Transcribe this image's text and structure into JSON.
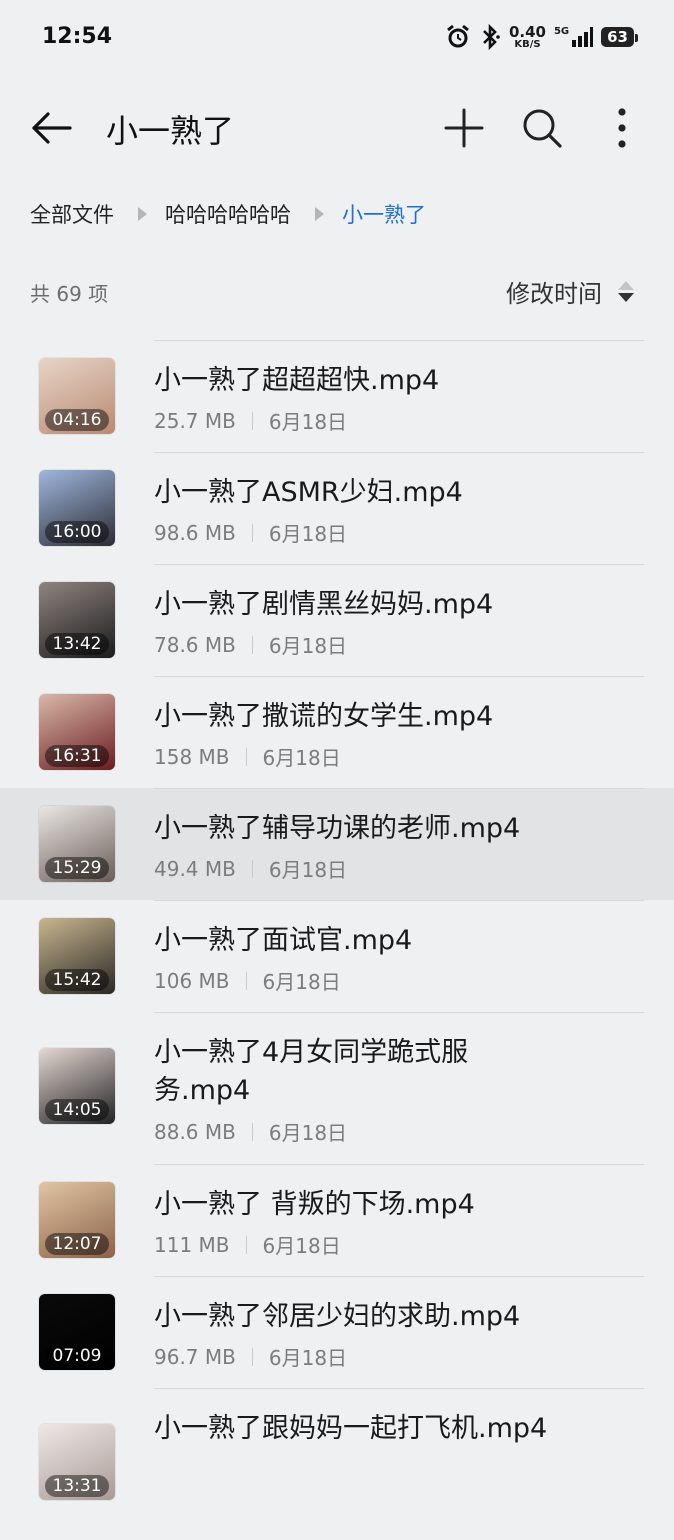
{
  "status": {
    "time": "12:54",
    "speed_value": "0.40",
    "speed_unit": "KB/S",
    "network": "5G",
    "battery": "63"
  },
  "appbar": {
    "title": "小一熟了",
    "icons": [
      "back-arrow-icon",
      "plus-icon",
      "search-icon",
      "more-vertical-icon"
    ]
  },
  "breadcrumb": {
    "items": [
      "全部文件",
      "哈哈哈哈哈哈",
      "小一熟了"
    ]
  },
  "summary": {
    "count_text": "共 69 项"
  },
  "sort": {
    "label": "修改时间"
  },
  "colors": {
    "accent": "#1f6fd6",
    "background": "#eff0f2",
    "highlight": "#e2e3e5"
  },
  "files": [
    {
      "name": "小一熟了超超超快.mp4",
      "size": "25.7 MB",
      "date": "6月18日",
      "duration": "04:16",
      "thumb_colors": [
        "#e8d4c8",
        "#b88a72"
      ]
    },
    {
      "name": "小一熟了ASMR少妇.mp4",
      "size": "98.6 MB",
      "date": "6月18日",
      "duration": "16:00",
      "thumb_colors": [
        "#9eb7dd",
        "#2c2c34"
      ]
    },
    {
      "name": "小一熟了剧情黑丝妈妈.mp4",
      "size": "78.6 MB",
      "date": "6月18日",
      "duration": "13:42",
      "thumb_colors": [
        "#8f8580",
        "#1b1b1d"
      ]
    },
    {
      "name": "小一熟了撒谎的女学生.mp4",
      "size": "158 MB",
      "date": "6月18日",
      "duration": "16:31",
      "thumb_colors": [
        "#d8b8a8",
        "#6b1c22"
      ]
    },
    {
      "name": "小一熟了辅导功课的老师.mp4",
      "size": "49.4 MB",
      "date": "6月18日",
      "duration": "15:29",
      "thumb_colors": [
        "#e9e6e4",
        "#6a5d58"
      ]
    },
    {
      "name": "小一熟了面试官.mp4",
      "size": "106 MB",
      "date": "6月18日",
      "duration": "15:42",
      "thumb_colors": [
        "#c8b690",
        "#2a2825"
      ]
    },
    {
      "name": "小一熟了4月女同学跪式服务.mp4",
      "size": "88.6 MB",
      "date": "6月18日",
      "duration": "14:05",
      "thumb_colors": [
        "#e4d8d2",
        "#222224"
      ]
    },
    {
      "name": "小一熟了 背叛的下场.mp4",
      "size": "111 MB",
      "date": "6月18日",
      "duration": "12:07",
      "thumb_colors": [
        "#e0c5a4",
        "#8c6248"
      ]
    },
    {
      "name": "小一熟了邻居少妇的求助.mp4",
      "size": "96.7 MB",
      "date": "6月18日",
      "duration": "07:09",
      "thumb_colors": [
        "#0a0a0a",
        "#000000"
      ]
    },
    {
      "name": "小一熟了跟妈妈一起打飞机.mp4",
      "size": "",
      "date": "",
      "duration": "13:31",
      "thumb_colors": [
        "#efe8e6",
        "#a89a96"
      ]
    }
  ]
}
